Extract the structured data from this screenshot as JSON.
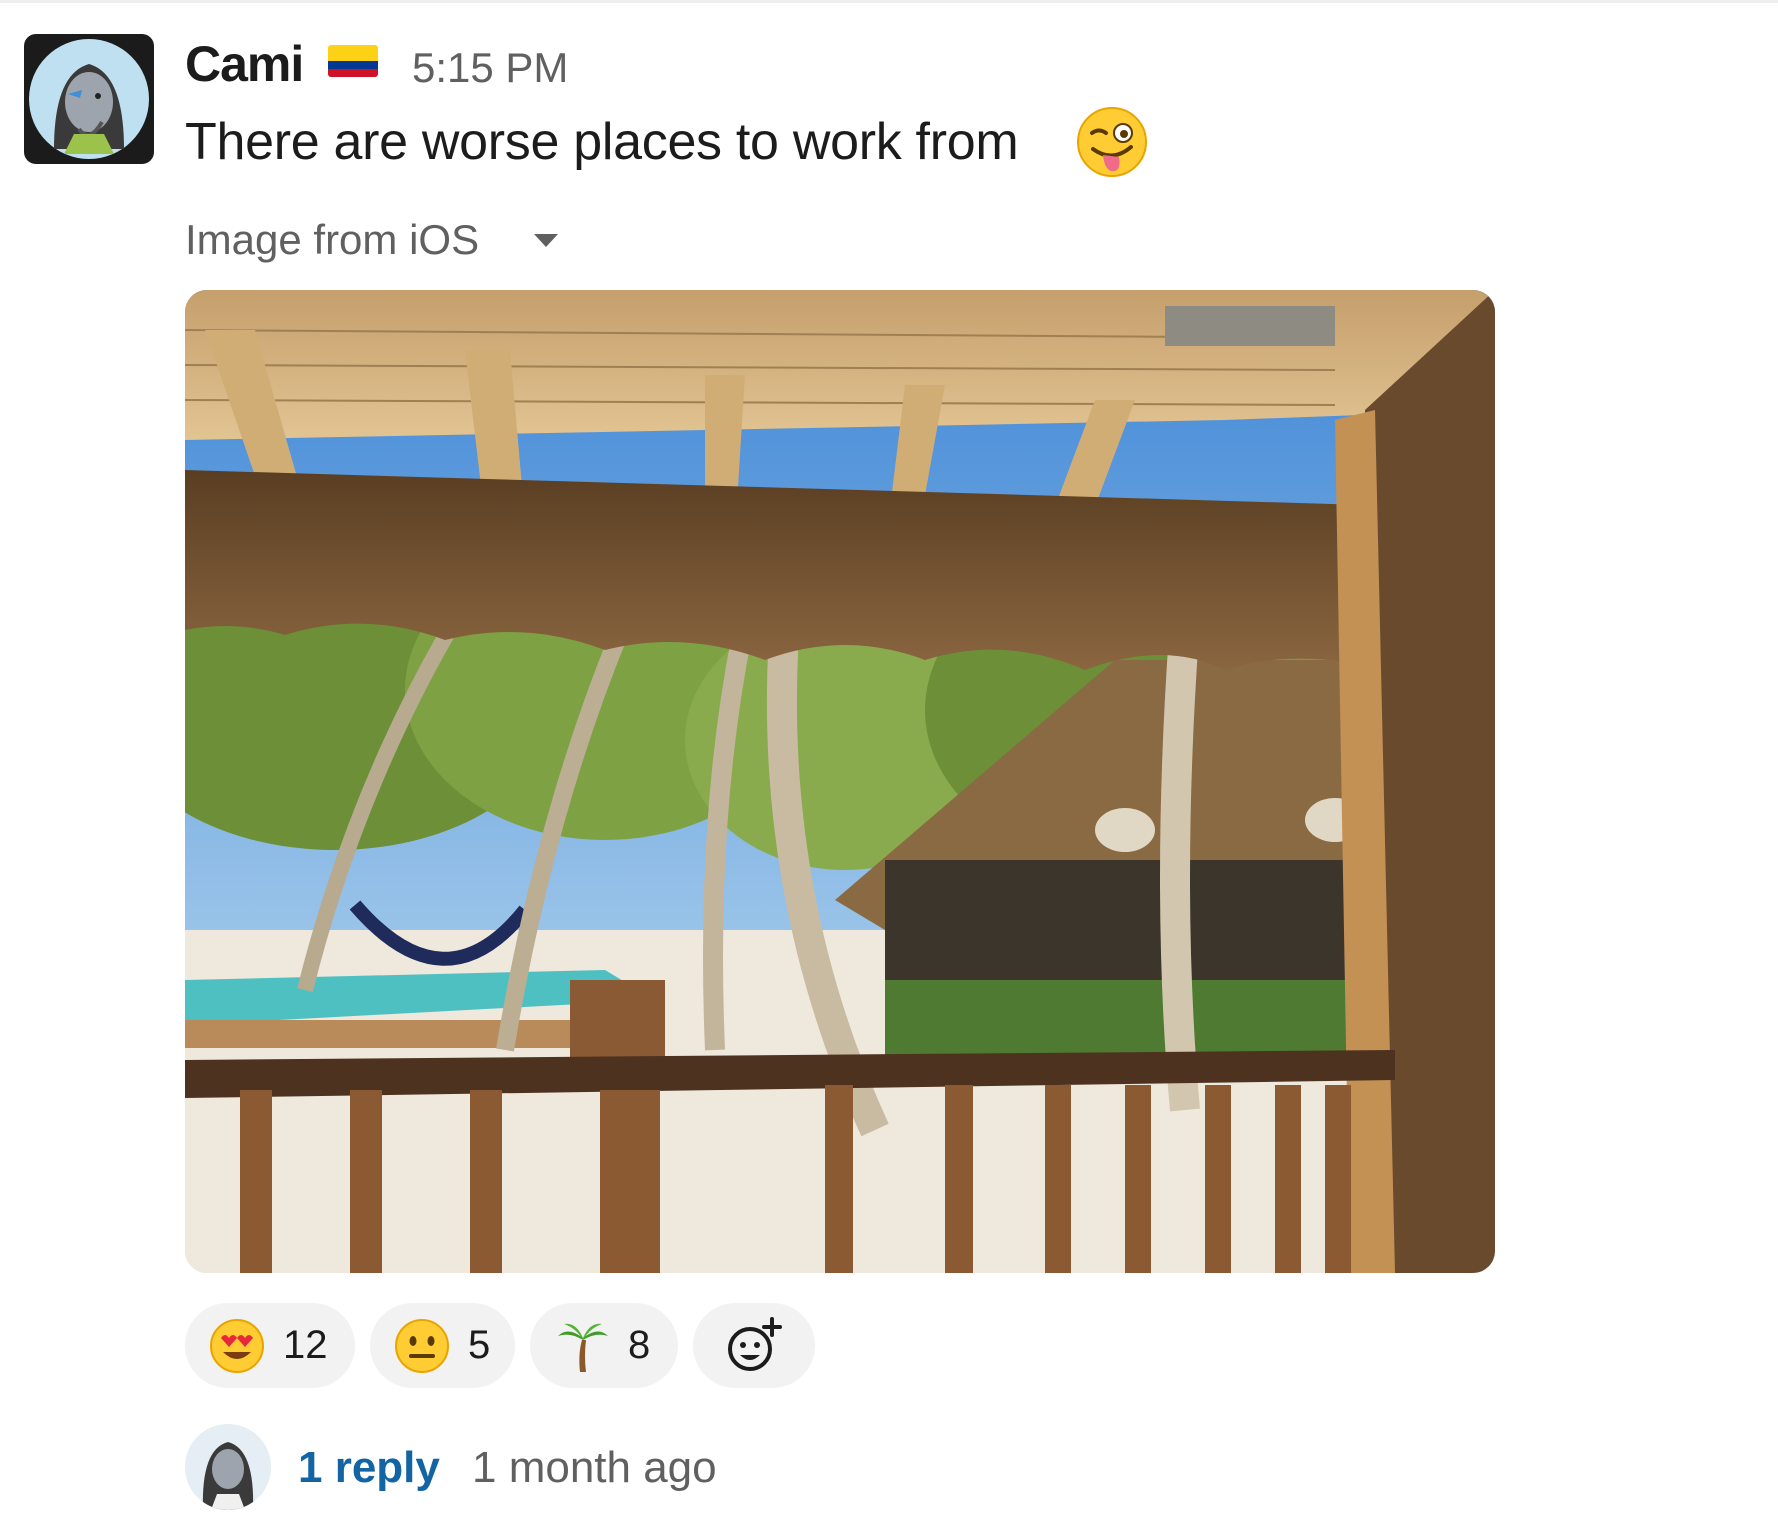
{
  "message": {
    "author": "Cami",
    "status_emoji": "flag-colombia-icon",
    "time": "5:15 PM",
    "text": "There are worse places to work from",
    "inline_emoji": "winking-tongue-emoji"
  },
  "attachment": {
    "label": "Image from iOS",
    "image": "beach-resort-photo"
  },
  "reactions": [
    {
      "emoji": "heart-eyes-emoji",
      "count": "12"
    },
    {
      "emoji": "neutral-face-emoji",
      "count": "5"
    },
    {
      "emoji": "palm-tree-emoji",
      "count": "8"
    }
  ],
  "add_reaction": "add-reaction-icon",
  "thread": {
    "reply_count": "1 reply",
    "last_reply": "1 month ago"
  },
  "colors": {
    "link": "#1264a3",
    "muted": "#616061",
    "reaction_bg": "#f2f2f2"
  }
}
